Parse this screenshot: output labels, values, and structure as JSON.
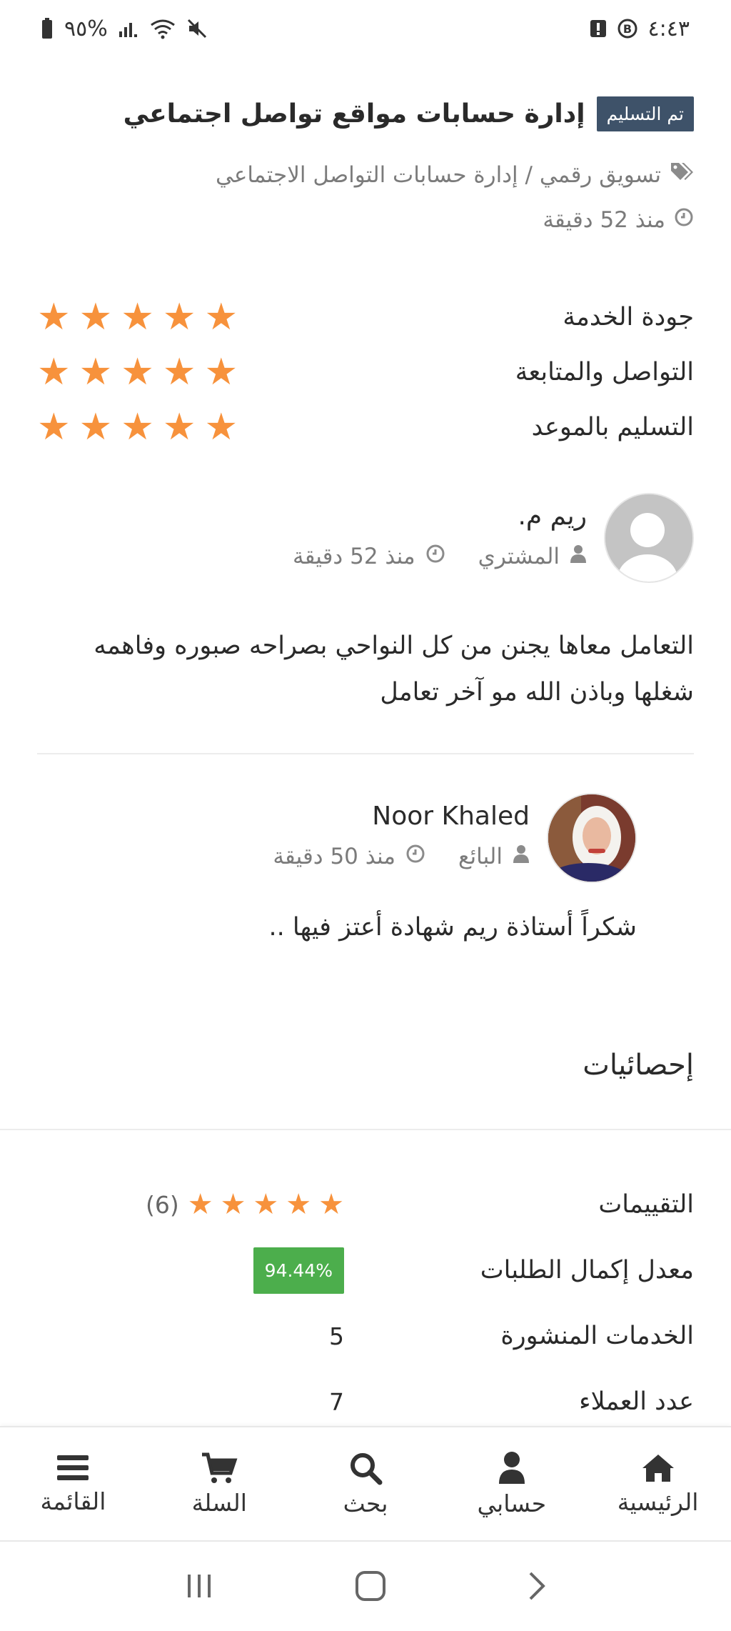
{
  "status_bar": {
    "time": "٤:٤٣",
    "battery": "٩٥%"
  },
  "header": {
    "badge": "تم التسليم",
    "title": "إدارة حسابات مواقع تواصل اجتماعي",
    "categories": "تسويق رقمي / إدارة حسابات التواصل الاجتماعي",
    "time": "منذ 52 دقيقة"
  },
  "ratings": [
    {
      "label": "جودة الخدمة",
      "stars": 5
    },
    {
      "label": "التواصل والمتابعة",
      "stars": 5
    },
    {
      "label": "التسليم بالموعد",
      "stars": 5
    }
  ],
  "review": {
    "name": "ريم م.",
    "role": "المشتري",
    "time": "منذ 52 دقيقة",
    "text": "التعامل معاها يجنن من كل النواحي بصراحه صبوره وفاهمه شغلها وباذن الله مو آخر تعامل"
  },
  "reply": {
    "name": "Noor Khaled",
    "role": "البائع",
    "time": "منذ 50 دقيقة",
    "text": "شكراً أستاذة ريم شهادة أعتز فيها .."
  },
  "stats": {
    "title": "إحصائيات",
    "ratings_label": "التقييمات",
    "ratings_count": "(6)",
    "ratings_stars": 5,
    "completion_label": "معدل إكمال الطلبات",
    "completion_value": "94.44%",
    "services_label": "الخدمات المنشورة",
    "services_value": "5",
    "clients_label": "عدد العملاء",
    "clients_value": "7"
  },
  "bottom_nav": {
    "home": "الرئيسية",
    "account": "حسابي",
    "search": "بحث",
    "cart": "السلة",
    "menu": "القائمة"
  },
  "colors": {
    "star": "#f7923c",
    "badge_bg": "#3e5269",
    "completion_bg": "#4cae4c"
  }
}
